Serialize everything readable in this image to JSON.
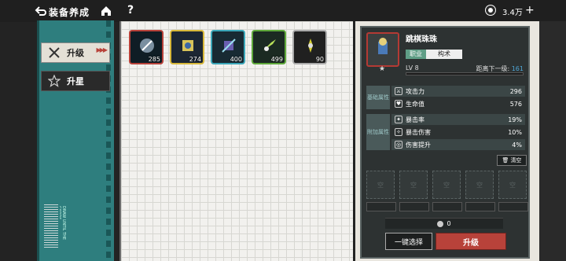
{
  "header": {
    "title": "装备养成",
    "currency_value": "3.4万",
    "help_label": "?"
  },
  "sidebar": {
    "tabs": [
      {
        "label": "升级",
        "active": true
      },
      {
        "label": "升星",
        "active": false
      }
    ],
    "barcode_text": "DRAW UNTIL THE CARDS"
  },
  "items": [
    {
      "count": "285",
      "border": "#b8423a",
      "bg": "#0f1d25"
    },
    {
      "count": "274",
      "border": "#d8b83a",
      "bg": "#1c2633"
    },
    {
      "count": "400",
      "border": "#3aa6b8",
      "bg": "#182a33"
    },
    {
      "count": "499",
      "border": "#5ea83a",
      "bg": "#1b2a22"
    },
    {
      "count": "90",
      "border": "#aaaaaa",
      "bg": "#202020"
    }
  ],
  "detail": {
    "name": "跳棋珠珠",
    "job_label": "职业",
    "job_value": "构术",
    "level": "LV 8",
    "next_label": "距离下一级:",
    "next_value": "161",
    "xp_fraction": 0,
    "base_group_label": "基础属性",
    "extra_group_label": "附加属性",
    "base_stats": [
      {
        "name": "攻击力",
        "value": "296",
        "icon": "sword-icon"
      },
      {
        "name": "生命值",
        "value": "576",
        "icon": "heart-icon"
      }
    ],
    "extra_stats": [
      {
        "name": "暴击率",
        "value": "19%",
        "icon": "crit-rate-icon"
      },
      {
        "name": "暴击伤害",
        "value": "10%",
        "icon": "crit-damage-icon"
      },
      {
        "name": "伤害提升",
        "value": "4%",
        "icon": "damage-boost-icon"
      }
    ],
    "clear_label": "清空",
    "slot_placeholder": "空",
    "cost_value": "0",
    "auto_select_label": "一键选择",
    "upgrade_label": "升级"
  },
  "colors": {
    "accent_red": "#b8423a",
    "teal": "#2e7e7e",
    "link_blue": "#4ea6d6"
  }
}
